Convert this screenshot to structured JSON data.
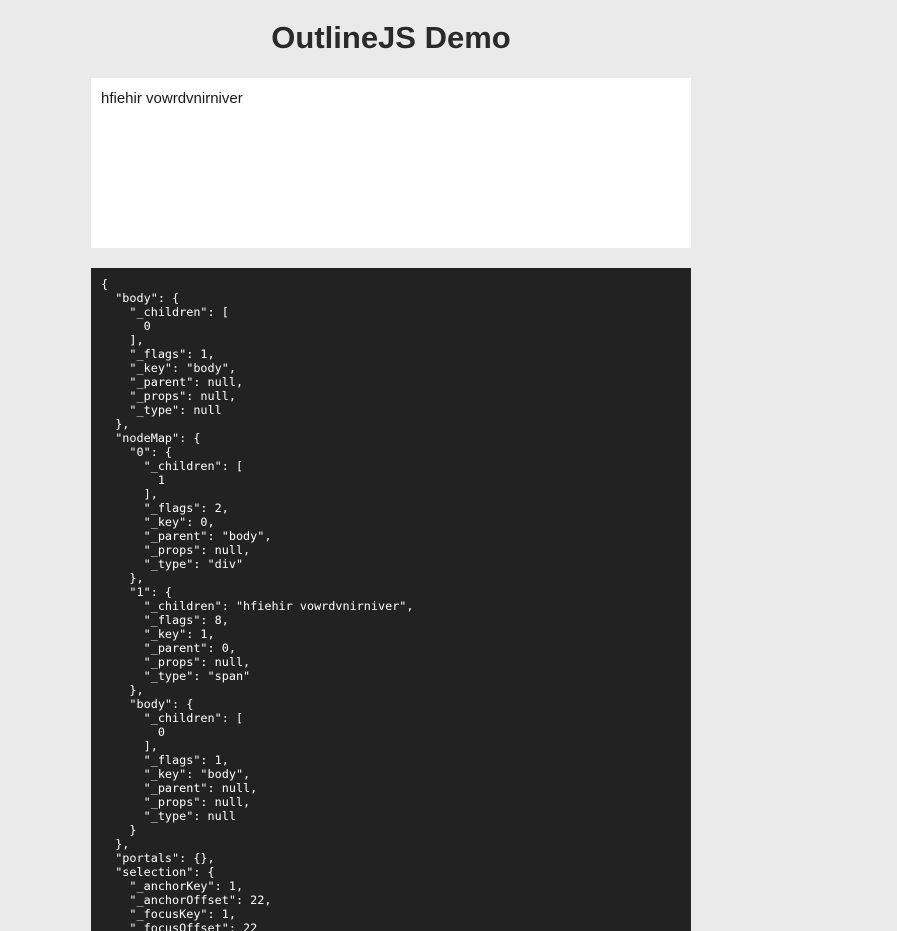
{
  "header": {
    "title": "OutlineJS Demo"
  },
  "editor": {
    "content": "hfiehir vowrdvnirniver"
  },
  "state_view": {
    "json_text": "{\n  \"body\": {\n    \"_children\": [\n      0\n    ],\n    \"_flags\": 1,\n    \"_key\": \"body\",\n    \"_parent\": null,\n    \"_props\": null,\n    \"_type\": null\n  },\n  \"nodeMap\": {\n    \"0\": {\n      \"_children\": [\n        1\n      ],\n      \"_flags\": 2,\n      \"_key\": 0,\n      \"_parent\": \"body\",\n      \"_props\": null,\n      \"_type\": \"div\"\n    },\n    \"1\": {\n      \"_children\": \"hfiehir vowrdvnirniver\",\n      \"_flags\": 8,\n      \"_key\": 1,\n      \"_parent\": 0,\n      \"_props\": null,\n      \"_type\": \"span\"\n    },\n    \"body\": {\n      \"_children\": [\n        0\n      ],\n      \"_flags\": 1,\n      \"_key\": \"body\",\n      \"_parent\": null,\n      \"_props\": null,\n      \"_type\": null\n    }\n  },\n  \"portals\": {},\n  \"selection\": {\n    \"_anchorKey\": 1,\n    \"_anchorOffset\": 22,\n    \"_focusKey\": 1,\n    \"_focusOffset\": 22"
  }
}
